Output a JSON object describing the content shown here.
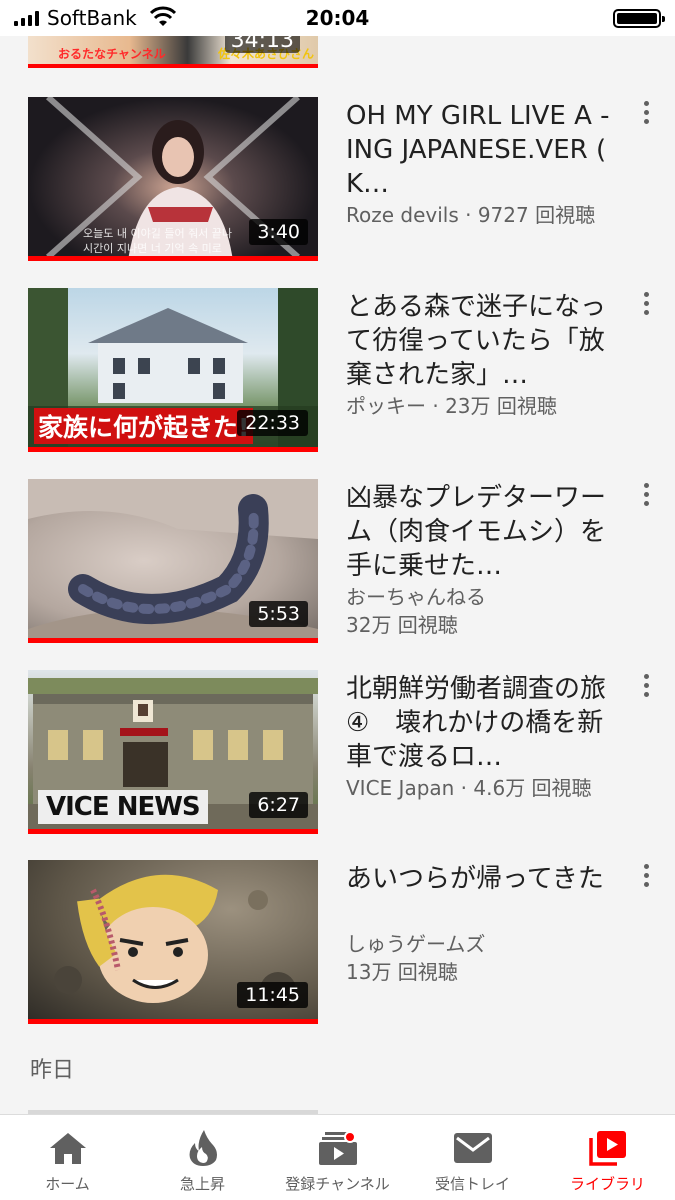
{
  "status_bar": {
    "carrier": "SoftBank",
    "time": "20:04"
  },
  "partial_item": {
    "duration": "34:13",
    "overlay_left": "おるたなチャンネル",
    "overlay_right": "佐々木あさひさん"
  },
  "videos": [
    {
      "title": "OH MY GIRL LIVE A - ING JAPANESE.VER ( K…",
      "channel_views": "Roze devils · 9727 回視聴",
      "channel": "",
      "views": "",
      "duration": "3:40",
      "overlay": ""
    },
    {
      "title": "とある森で迷子になって彷徨っていたら「放棄された家」…",
      "channel_views": "ポッキー · 23万 回視聴",
      "channel": "",
      "views": "",
      "duration": "22:33",
      "overlay": "家族に何が起きた!"
    },
    {
      "title": "凶暴なプレデターワーム（肉食イモムシ）を手に乗せた…",
      "channel_views": "",
      "channel": "おーちゃんねる",
      "views": "32万 回視聴",
      "duration": "5:53",
      "overlay": ""
    },
    {
      "title": "北朝鮮労働者調査の旅 ④　壊れかけの橋を新車で渡るロ…",
      "channel_views": "VICE Japan · 4.6万 回視聴",
      "channel": "",
      "views": "",
      "duration": "6:27",
      "overlay": "VICE NEWS"
    },
    {
      "title": "あいつらが帰ってきた",
      "channel_views": "",
      "channel": "しゅうゲームズ",
      "views": "13万 回視聴",
      "duration": "11:45",
      "overlay": ""
    }
  ],
  "section_header": "昨日",
  "bottom_nav": [
    {
      "label": "ホーム",
      "icon": "home-icon",
      "active": false
    },
    {
      "label": "急上昇",
      "icon": "trending-flame-icon",
      "active": false
    },
    {
      "label": "登録チャンネル",
      "icon": "subscriptions-icon",
      "active": false
    },
    {
      "label": "受信トレイ",
      "icon": "inbox-mail-icon",
      "active": false
    },
    {
      "label": "ライブラリ",
      "icon": "library-icon",
      "active": true
    }
  ],
  "colors": {
    "accent": "#ff0000",
    "text_primary": "#212121",
    "text_secondary": "#606060",
    "background": "#f4f4f4"
  }
}
